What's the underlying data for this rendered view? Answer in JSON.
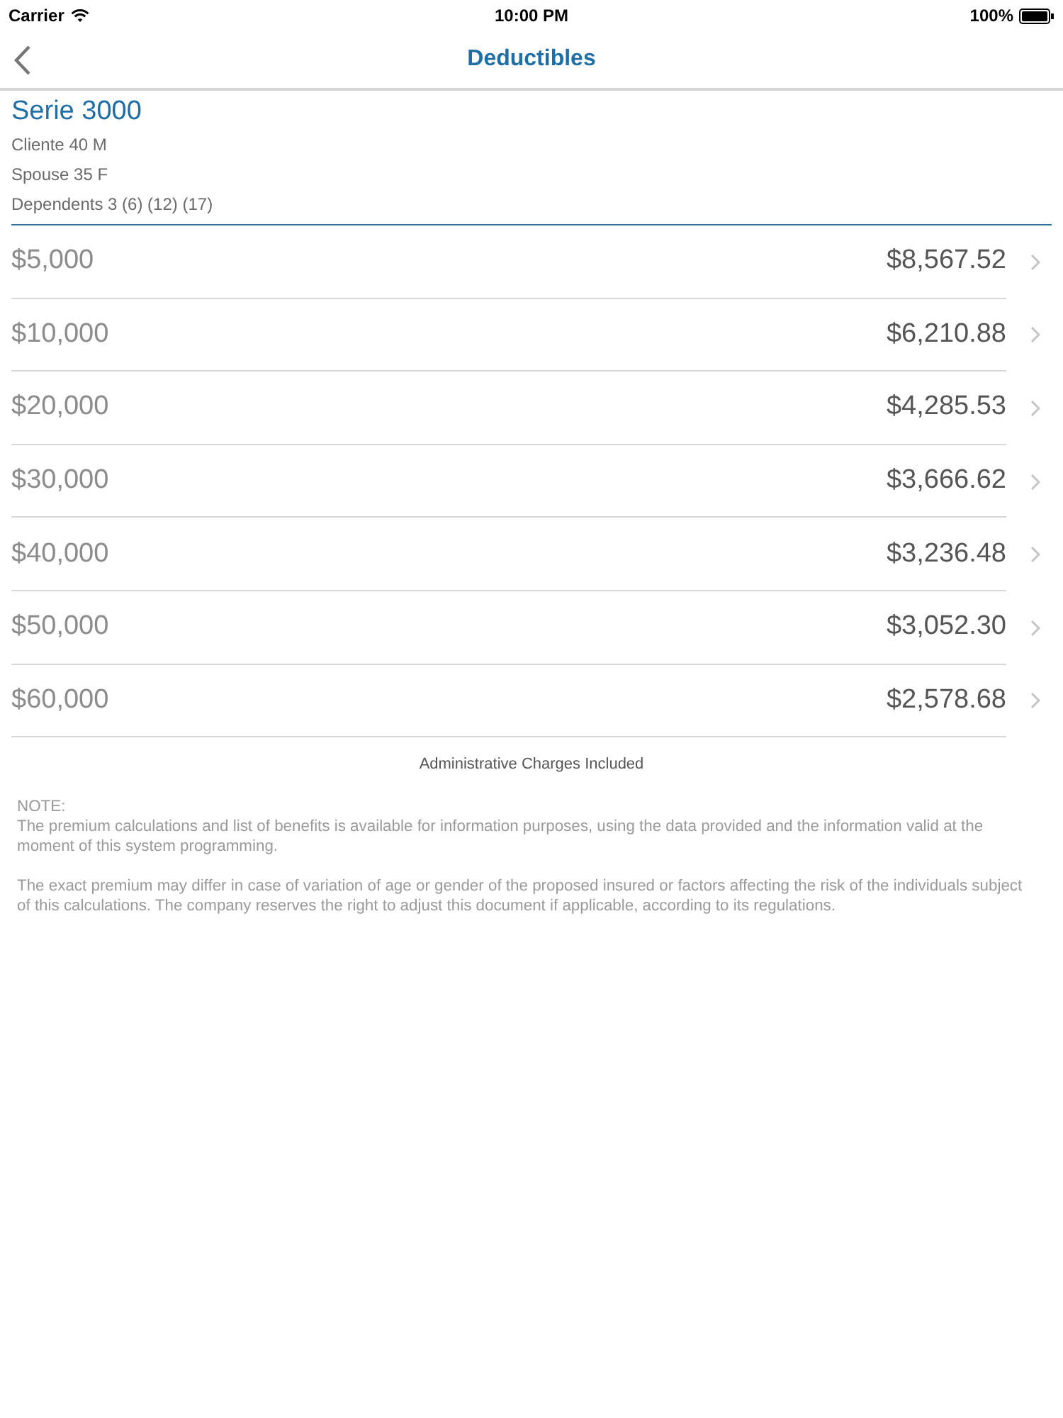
{
  "status_bar": {
    "carrier": "Carrier",
    "time": "10:00 PM",
    "battery": "100%"
  },
  "nav_bar": {
    "title": "Deductibles"
  },
  "header": {
    "title": "Serie 3000",
    "lines": [
      "Cliente 40 M",
      "Spouse 35 F",
      "Dependents 3 (6) (12) (17)"
    ]
  },
  "rows": [
    {
      "deductible": "$5,000",
      "premium": "$8,567.52"
    },
    {
      "deductible": "$10,000",
      "premium": "$6,210.88"
    },
    {
      "deductible": "$20,000",
      "premium": "$4,285.53"
    },
    {
      "deductible": "$30,000",
      "premium": "$3,666.62"
    },
    {
      "deductible": "$40,000",
      "premium": "$3,236.48"
    },
    {
      "deductible": "$50,000",
      "premium": "$3,052.30"
    },
    {
      "deductible": "$60,000",
      "premium": "$2,578.68"
    }
  ],
  "footer_caption": "Administrative Charges Included",
  "note": {
    "label": "NOTE:",
    "paragraphs": [
      "The premium calculations and list of benefits is available for information purposes, using the data provided and the information valid at the moment of this system programming.",
      "The exact premium may differ in case of variation of age or gender of the proposed insured or factors affecting the risk of the individuals subject of this calculations. The company reserves the right to adjust this document if applicable, according to its regulations."
    ]
  }
}
